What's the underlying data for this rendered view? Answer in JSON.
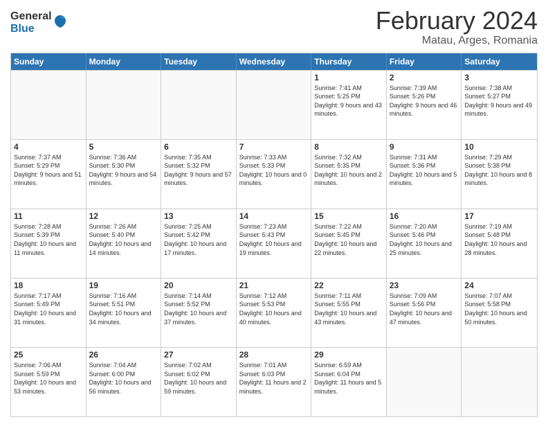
{
  "header": {
    "logo": {
      "general": "General",
      "blue": "Blue"
    },
    "title": "February 2024",
    "subtitle": "Matau, Arges, Romania"
  },
  "weekdays": [
    "Sunday",
    "Monday",
    "Tuesday",
    "Wednesday",
    "Thursday",
    "Friday",
    "Saturday"
  ],
  "weeks": [
    [
      {
        "day": "",
        "sunrise": "",
        "sunset": "",
        "daylight": "",
        "empty": true
      },
      {
        "day": "",
        "sunrise": "",
        "sunset": "",
        "daylight": "",
        "empty": true
      },
      {
        "day": "",
        "sunrise": "",
        "sunset": "",
        "daylight": "",
        "empty": true
      },
      {
        "day": "",
        "sunrise": "",
        "sunset": "",
        "daylight": "",
        "empty": true
      },
      {
        "day": "1",
        "sunrise": "Sunrise: 7:41 AM",
        "sunset": "Sunset: 5:25 PM",
        "daylight": "Daylight: 9 hours and 43 minutes.",
        "empty": false
      },
      {
        "day": "2",
        "sunrise": "Sunrise: 7:39 AM",
        "sunset": "Sunset: 5:26 PM",
        "daylight": "Daylight: 9 hours and 46 minutes.",
        "empty": false
      },
      {
        "day": "3",
        "sunrise": "Sunrise: 7:38 AM",
        "sunset": "Sunset: 5:27 PM",
        "daylight": "Daylight: 9 hours and 49 minutes.",
        "empty": false
      }
    ],
    [
      {
        "day": "4",
        "sunrise": "Sunrise: 7:37 AM",
        "sunset": "Sunset: 5:29 PM",
        "daylight": "Daylight: 9 hours and 51 minutes.",
        "empty": false
      },
      {
        "day": "5",
        "sunrise": "Sunrise: 7:36 AM",
        "sunset": "Sunset: 5:30 PM",
        "daylight": "Daylight: 9 hours and 54 minutes.",
        "empty": false
      },
      {
        "day": "6",
        "sunrise": "Sunrise: 7:35 AM",
        "sunset": "Sunset: 5:32 PM",
        "daylight": "Daylight: 9 hours and 57 minutes.",
        "empty": false
      },
      {
        "day": "7",
        "sunrise": "Sunrise: 7:33 AM",
        "sunset": "Sunset: 5:33 PM",
        "daylight": "Daylight: 10 hours and 0 minutes.",
        "empty": false
      },
      {
        "day": "8",
        "sunrise": "Sunrise: 7:32 AM",
        "sunset": "Sunset: 5:35 PM",
        "daylight": "Daylight: 10 hours and 2 minutes.",
        "empty": false
      },
      {
        "day": "9",
        "sunrise": "Sunrise: 7:31 AM",
        "sunset": "Sunset: 5:36 PM",
        "daylight": "Daylight: 10 hours and 5 minutes.",
        "empty": false
      },
      {
        "day": "10",
        "sunrise": "Sunrise: 7:29 AM",
        "sunset": "Sunset: 5:38 PM",
        "daylight": "Daylight: 10 hours and 8 minutes.",
        "empty": false
      }
    ],
    [
      {
        "day": "11",
        "sunrise": "Sunrise: 7:28 AM",
        "sunset": "Sunset: 5:39 PM",
        "daylight": "Daylight: 10 hours and 11 minutes.",
        "empty": false
      },
      {
        "day": "12",
        "sunrise": "Sunrise: 7:26 AM",
        "sunset": "Sunset: 5:40 PM",
        "daylight": "Daylight: 10 hours and 14 minutes.",
        "empty": false
      },
      {
        "day": "13",
        "sunrise": "Sunrise: 7:25 AM",
        "sunset": "Sunset: 5:42 PM",
        "daylight": "Daylight: 10 hours and 17 minutes.",
        "empty": false
      },
      {
        "day": "14",
        "sunrise": "Sunrise: 7:23 AM",
        "sunset": "Sunset: 5:43 PM",
        "daylight": "Daylight: 10 hours and 19 minutes.",
        "empty": false
      },
      {
        "day": "15",
        "sunrise": "Sunrise: 7:22 AM",
        "sunset": "Sunset: 5:45 PM",
        "daylight": "Daylight: 10 hours and 22 minutes.",
        "empty": false
      },
      {
        "day": "16",
        "sunrise": "Sunrise: 7:20 AM",
        "sunset": "Sunset: 5:46 PM",
        "daylight": "Daylight: 10 hours and 25 minutes.",
        "empty": false
      },
      {
        "day": "17",
        "sunrise": "Sunrise: 7:19 AM",
        "sunset": "Sunset: 5:48 PM",
        "daylight": "Daylight: 10 hours and 28 minutes.",
        "empty": false
      }
    ],
    [
      {
        "day": "18",
        "sunrise": "Sunrise: 7:17 AM",
        "sunset": "Sunset: 5:49 PM",
        "daylight": "Daylight: 10 hours and 31 minutes.",
        "empty": false
      },
      {
        "day": "19",
        "sunrise": "Sunrise: 7:16 AM",
        "sunset": "Sunset: 5:51 PM",
        "daylight": "Daylight: 10 hours and 34 minutes.",
        "empty": false
      },
      {
        "day": "20",
        "sunrise": "Sunrise: 7:14 AM",
        "sunset": "Sunset: 5:52 PM",
        "daylight": "Daylight: 10 hours and 37 minutes.",
        "empty": false
      },
      {
        "day": "21",
        "sunrise": "Sunrise: 7:12 AM",
        "sunset": "Sunset: 5:53 PM",
        "daylight": "Daylight: 10 hours and 40 minutes.",
        "empty": false
      },
      {
        "day": "22",
        "sunrise": "Sunrise: 7:11 AM",
        "sunset": "Sunset: 5:55 PM",
        "daylight": "Daylight: 10 hours and 43 minutes.",
        "empty": false
      },
      {
        "day": "23",
        "sunrise": "Sunrise: 7:09 AM",
        "sunset": "Sunset: 5:56 PM",
        "daylight": "Daylight: 10 hours and 47 minutes.",
        "empty": false
      },
      {
        "day": "24",
        "sunrise": "Sunrise: 7:07 AM",
        "sunset": "Sunset: 5:58 PM",
        "daylight": "Daylight: 10 hours and 50 minutes.",
        "empty": false
      }
    ],
    [
      {
        "day": "25",
        "sunrise": "Sunrise: 7:06 AM",
        "sunset": "Sunset: 5:59 PM",
        "daylight": "Daylight: 10 hours and 53 minutes.",
        "empty": false
      },
      {
        "day": "26",
        "sunrise": "Sunrise: 7:04 AM",
        "sunset": "Sunset: 6:00 PM",
        "daylight": "Daylight: 10 hours and 56 minutes.",
        "empty": false
      },
      {
        "day": "27",
        "sunrise": "Sunrise: 7:02 AM",
        "sunset": "Sunset: 6:02 PM",
        "daylight": "Daylight: 10 hours and 59 minutes.",
        "empty": false
      },
      {
        "day": "28",
        "sunrise": "Sunrise: 7:01 AM",
        "sunset": "Sunset: 6:03 PM",
        "daylight": "Daylight: 11 hours and 2 minutes.",
        "empty": false
      },
      {
        "day": "29",
        "sunrise": "Sunrise: 6:59 AM",
        "sunset": "Sunset: 6:04 PM",
        "daylight": "Daylight: 11 hours and 5 minutes.",
        "empty": false
      },
      {
        "day": "",
        "sunrise": "",
        "sunset": "",
        "daylight": "",
        "empty": true
      },
      {
        "day": "",
        "sunrise": "",
        "sunset": "",
        "daylight": "",
        "empty": true
      }
    ]
  ]
}
